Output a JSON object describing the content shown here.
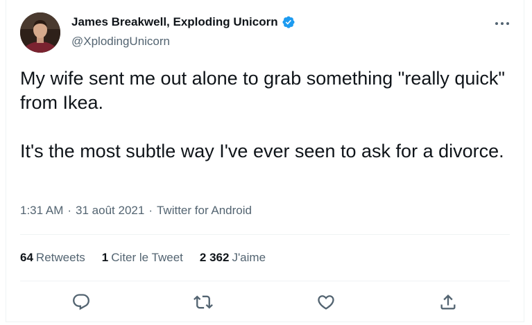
{
  "tweet": {
    "author": {
      "display_name": "James Breakwell, Exploding Unicorn",
      "handle": "@XplodingUnicorn",
      "verified_icon": "verified-badge-icon",
      "avatar_icon": "avatar"
    },
    "text": "My wife sent me out alone to grab something \"really quick\" from Ikea.\n\nIt's the most subtle way I've ever seen to ask for a divorce.",
    "meta": {
      "time": "1:31 AM",
      "separator_1": "·",
      "date": "31 août 2021",
      "separator_2": "·",
      "source": "Twitter for Android"
    },
    "stats": {
      "retweets_count": "64",
      "retweets_label": "Retweets",
      "quotes_count": "1",
      "quotes_label": "Citer le Tweet",
      "likes_count": "2 362",
      "likes_label": "J'aime"
    },
    "actions": [
      "reply-icon",
      "retweet-icon",
      "like-icon",
      "share-icon"
    ]
  },
  "colors": {
    "text_primary": "#0f1419",
    "text_secondary": "#536471",
    "verified": "#1d9bf0",
    "divider": "#eff3f4"
  }
}
